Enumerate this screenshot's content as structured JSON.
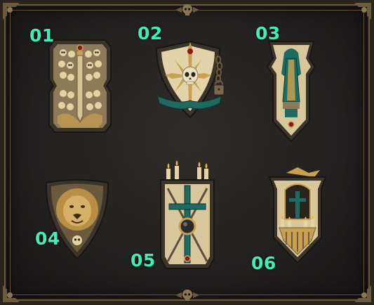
{
  "labels": {
    "s1": "01",
    "s2": "02",
    "s3": "03",
    "s4": "04",
    "s5": "05",
    "s6": "06"
  },
  "colors": {
    "label": "#3ef0b8",
    "metal_dark": "#3a342b",
    "bone": "#e6d3a4",
    "gold": "#c8a04f",
    "teal": "#1e6b62",
    "ruby": "#8a1a1a",
    "background": "#262321"
  },
  "icons": [
    "skull-icon",
    "sword-icon",
    "lion-head-icon",
    "cross-icon",
    "candle-icon",
    "chain-icon",
    "padlock-icon",
    "saint-statue-icon",
    "shrine-icon",
    "corner-ornament-icon"
  ]
}
